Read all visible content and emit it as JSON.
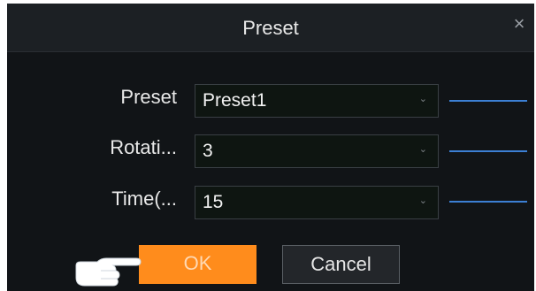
{
  "dialog": {
    "title": "Preset",
    "close_symbol": "×"
  },
  "fields": [
    {
      "label": "Preset",
      "value": "Preset1"
    },
    {
      "label": "Rotati...",
      "value": "3"
    },
    {
      "label": "Time(...",
      "value": "15"
    }
  ],
  "buttons": {
    "ok_label": "OK",
    "cancel_label": "Cancel"
  },
  "icons": {
    "dropdown": "chevron-down-icon",
    "close": "close-icon",
    "hand": "pointing-hand-icon"
  },
  "colors": {
    "accent": "#ff8c1c",
    "callout_line": "#3c7fd3",
    "pointer_hand": "#ffffff"
  }
}
